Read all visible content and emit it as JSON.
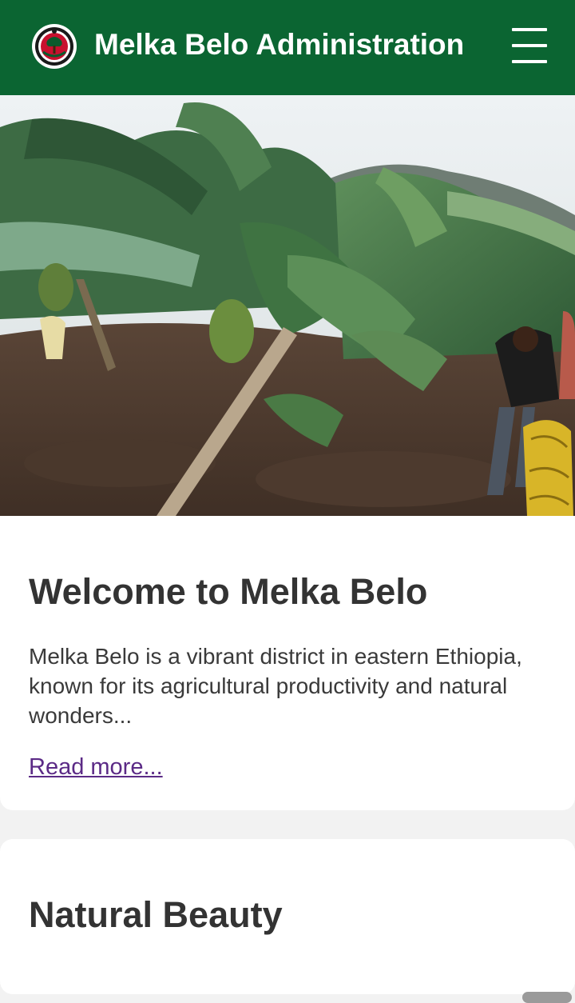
{
  "header": {
    "title": "Melka Belo Administration",
    "background_color": "#0b6532",
    "logo_icon": "oromia-emblem-icon",
    "menu_icon": "hamburger-menu-icon"
  },
  "hero": {
    "image": "banana-plantation-photo"
  },
  "welcome_card": {
    "heading": "Welcome to Melka Belo",
    "intro": "Melka Belo is a vibrant district in eastern Ethiopia, known for its agricultural productivity and natural wonders...",
    "read_more": "Read more...",
    "link_color": "#5b2a86"
  },
  "nature_card": {
    "heading": "Natural Beauty"
  }
}
